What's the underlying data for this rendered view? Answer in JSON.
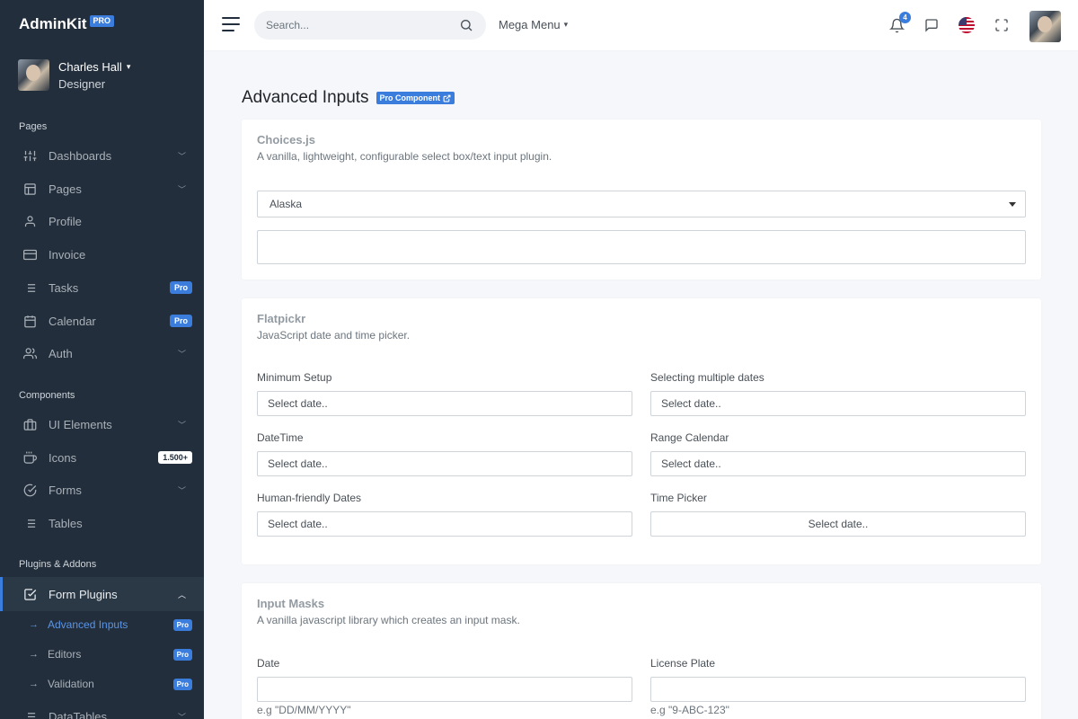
{
  "brand": {
    "name": "AdminKit",
    "badge": "PRO"
  },
  "user": {
    "name": "Charles Hall",
    "role": "Designer"
  },
  "sidebar": {
    "sections": [
      "Pages",
      "Components",
      "Plugins & Addons"
    ],
    "pages": [
      {
        "label": "Dashboards",
        "icon": "sliders-icon"
      },
      {
        "label": "Pages",
        "icon": "layout-icon"
      },
      {
        "label": "Profile",
        "icon": "user-icon"
      },
      {
        "label": "Invoice",
        "icon": "credit-card-icon"
      },
      {
        "label": "Tasks",
        "icon": "list-icon",
        "badge": "Pro"
      },
      {
        "label": "Calendar",
        "icon": "calendar-icon",
        "badge": "Pro"
      },
      {
        "label": "Auth",
        "icon": "users-icon"
      }
    ],
    "components": [
      {
        "label": "UI Elements",
        "icon": "briefcase-icon"
      },
      {
        "label": "Icons",
        "icon": "coffee-icon",
        "badge": "1.500+"
      },
      {
        "label": "Forms",
        "icon": "check-circle-icon"
      },
      {
        "label": "Tables",
        "icon": "list-icon"
      }
    ],
    "plugins": [
      {
        "label": "Form Plugins",
        "icon": "check-square-icon"
      },
      {
        "label": "DataTables",
        "icon": "list-icon"
      }
    ],
    "subitems": [
      {
        "label": "Advanced Inputs",
        "badge": "Pro"
      },
      {
        "label": "Editors",
        "badge": "Pro"
      },
      {
        "label": "Validation",
        "badge": "Pro"
      }
    ]
  },
  "topbar": {
    "search_placeholder": "Search...",
    "mega_menu": "Mega Menu",
    "notification_count": "4"
  },
  "page": {
    "title": "Advanced Inputs",
    "badge": "Pro Component"
  },
  "choices": {
    "title": "Choices.js",
    "subtitle": "A vanilla, lightweight, configurable select box/text input plugin.",
    "selected": "Alaska"
  },
  "flatpickr": {
    "title": "Flatpickr",
    "subtitle": "JavaScript date and time picker.",
    "placeholder": "Select date..",
    "labels": {
      "minimum": "Minimum Setup",
      "multiple": "Selecting multiple dates",
      "datetime": "DateTime",
      "range": "Range Calendar",
      "human": "Human-friendly Dates",
      "time": "Time Picker"
    }
  },
  "masks": {
    "title": "Input Masks",
    "subtitle": "A vanilla javascript library which creates an input mask.",
    "date_label": "Date",
    "date_hint": "e.g \"DD/MM/YYYY\"",
    "plate_label": "License Plate",
    "plate_hint": "e.g \"9-ABC-123\""
  }
}
